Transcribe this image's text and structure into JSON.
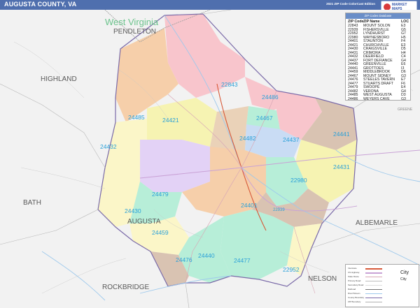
{
  "header": {
    "title": "AUGUSTA COUNTY, VA",
    "edition": "2021 ZIP Code ColorCast Edition"
  },
  "place_labels": {
    "state": "West Virginia",
    "pendleton": "PENDLETON",
    "highland": "HIGHLAND",
    "bath": "BATH",
    "augusta": "AUGUSTA",
    "rockbridge": "ROCKBRIDGE",
    "nelson": "NELSON",
    "albemarle": "ALBEMARLE",
    "greene": "GREENE"
  },
  "zip_labels": [
    "22843",
    "24486",
    "24467",
    "24485",
    "24421",
    "24482",
    "24437",
    "24441",
    "24432",
    "24431",
    "22980",
    "24479",
    "24401",
    "24430",
    "22939",
    "24459",
    "24476",
    "24440",
    "24477",
    "22952"
  ],
  "legend": {
    "header": "ZIP Codes Database",
    "col_zip": "ZIP Code",
    "col_name": "ZIP Name",
    "col_loc": "LOC",
    "rows": [
      {
        "zip": "22843",
        "name": "MOUNT SOLON",
        "loc": "E3"
      },
      {
        "zip": "22939",
        "name": "FISHERSVILLE",
        "loc": "G5"
      },
      {
        "zip": "22952",
        "name": "LYNDHURST",
        "loc": "G7"
      },
      {
        "zip": "22980",
        "name": "WAYNESBORO",
        "loc": "H5"
      },
      {
        "zip": "24401",
        "name": "STAUNTON",
        "loc": "F4"
      },
      {
        "zip": "24421",
        "name": "CHURCHVILLE",
        "loc": "E3"
      },
      {
        "zip": "24430",
        "name": "CRAIGSVILLE",
        "loc": "D5"
      },
      {
        "zip": "24431",
        "name": "CRIMORA",
        "loc": "H4"
      },
      {
        "zip": "24432",
        "name": "DEERFIELD",
        "loc": "C4"
      },
      {
        "zip": "24437",
        "name": "FORT DEFIANCE",
        "loc": "G4"
      },
      {
        "zip": "24440",
        "name": "GREENVILLE",
        "loc": "E6"
      },
      {
        "zip": "24441",
        "name": "GROTTOES",
        "loc": "I3"
      },
      {
        "zip": "24459",
        "name": "MIDDLEBROOK",
        "loc": "D6"
      },
      {
        "zip": "24467",
        "name": "MOUNT SIDNEY",
        "loc": "G3"
      },
      {
        "zip": "24476",
        "name": "STEELES TAVERN",
        "loc": "E7"
      },
      {
        "zip": "24477",
        "name": "STUARTS DRAFT",
        "loc": "F6"
      },
      {
        "zip": "24479",
        "name": "SWOOPE",
        "loc": "E4"
      },
      {
        "zip": "24482",
        "name": "VERONA",
        "loc": "G4"
      },
      {
        "zip": "24485",
        "name": "WEST AUGUSTA",
        "loc": "D3"
      },
      {
        "zip": "24486",
        "name": "WEYERS CAVE",
        "loc": "G3"
      }
    ]
  },
  "key": {
    "city_big": "City",
    "city_small": "City",
    "items": [
      "Interstate",
      "US Highway",
      "State Route",
      "Primary Road",
      "Secondary Road",
      "Railroad",
      "River/Stream",
      "County Boundary",
      "ZIP Boundary"
    ]
  },
  "colors": {
    "header_bg": "#4f6fae",
    "zip_label": "#2aa0d8",
    "county_label": "#5a5a5a",
    "state_label": "#6cc38d",
    "water": "#9ec9ec"
  }
}
